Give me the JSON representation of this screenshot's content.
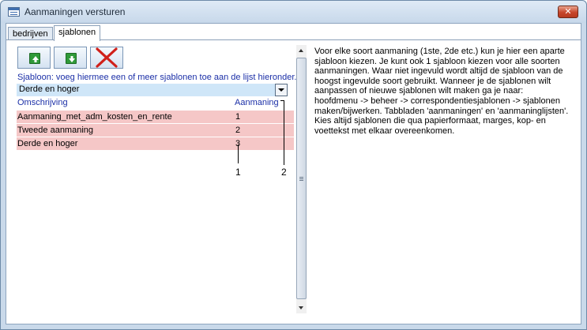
{
  "window": {
    "title": "Aanmaningen versturen",
    "close_label": "✕"
  },
  "tabs": [
    {
      "label": "bedrijven",
      "active": false
    },
    {
      "label": "sjablonen",
      "active": true
    }
  ],
  "toolbar": {
    "up_icon": "arrow-up-icon",
    "down_icon": "arrow-down-icon",
    "delete_icon": "red-x-delete-icon"
  },
  "hint": "Sjabloon: voeg hiermee een of meer sjablonen toe aan de lijst hieronder.",
  "combo": {
    "value": "Derde en hoger"
  },
  "table": {
    "columns": [
      "Omschrijving",
      "Aanmaning"
    ],
    "rows": [
      {
        "name": "Aanmaning_met_adm_kosten_en_rente",
        "level": "1"
      },
      {
        "name": "Tweede aanmaning",
        "level": "2"
      },
      {
        "name": "Derde en hoger",
        "level": "3"
      }
    ]
  },
  "annotations": {
    "one": "1",
    "two": "2"
  },
  "info_text": "Voor elke soort aanmaning (1ste, 2de etc.) kun je hier een aparte\nsjabloon kiezen. Je kunt ook 1 sjabloon kiezen voor alle soorten\naanmaningen. Waar niet ingevuld wordt altijd de sjabloon van de\nhoogst ingevulde soort gebruikt. Wanneer je de sjablonen wilt\naanpassen of nieuwe sjablonen wilt maken ga je naar:\nhoofdmenu -> beheer -> correspondentiesjablonen -> sjablonen\nmaken/bijwerken. Tabbladen 'aanmaningen' en 'aanmaninglijsten'.\nKies altijd sjablonen die qua papierformaat, marges, kop- en\nvoettekst met elkaar overeenkomen.",
  "colors": {
    "row_bg": "#f5c7c7",
    "combo_bg": "#cfe6f8",
    "header_text": "#1b2fa7",
    "button_green": "#2f9a39",
    "delete_red": "#d0201a"
  }
}
